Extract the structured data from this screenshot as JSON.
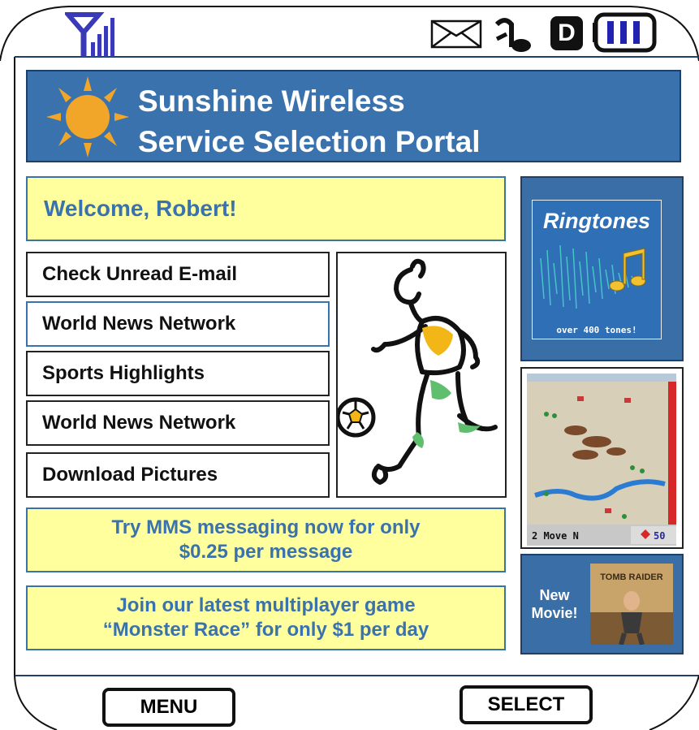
{
  "status_bar": {
    "icons": [
      "signal-icon",
      "envelope-icon",
      "voicemail-icon",
      "d-indicator-icon",
      "battery-icon"
    ],
    "d_indicator": "D"
  },
  "header": {
    "line1": "Sunshine Wireless",
    "line2": "Service Selection Portal",
    "logo_icon": "sun-icon"
  },
  "welcome": {
    "text": "Welcome, Robert!"
  },
  "menu": {
    "items": [
      {
        "label": "Check Unread E-mail"
      },
      {
        "label": "World News Network"
      },
      {
        "label": "Sports Highlights"
      },
      {
        "label": "World News Network"
      },
      {
        "label": "Download Pictures"
      }
    ]
  },
  "promos": [
    {
      "line1": "Try MMS messaging now for only",
      "line2": "$0.25 per message"
    },
    {
      "line1": "Join our latest multiplayer game",
      "line2": "“Monster Race” for only $1 per day"
    }
  ],
  "ringtones": {
    "title": "Ringtones",
    "caption": "over 400 tones!"
  },
  "game": {
    "left_status": "2 Move N",
    "right_status": "50"
  },
  "movie": {
    "line1": "New",
    "line2": "Movie!",
    "poster_text": "TOMB RAIDER"
  },
  "softkeys": {
    "left": "MENU",
    "right": "SELECT"
  },
  "colors": {
    "accent": "#3a72ad",
    "highlight": "#ffff9e",
    "sun": "#f2a629"
  }
}
